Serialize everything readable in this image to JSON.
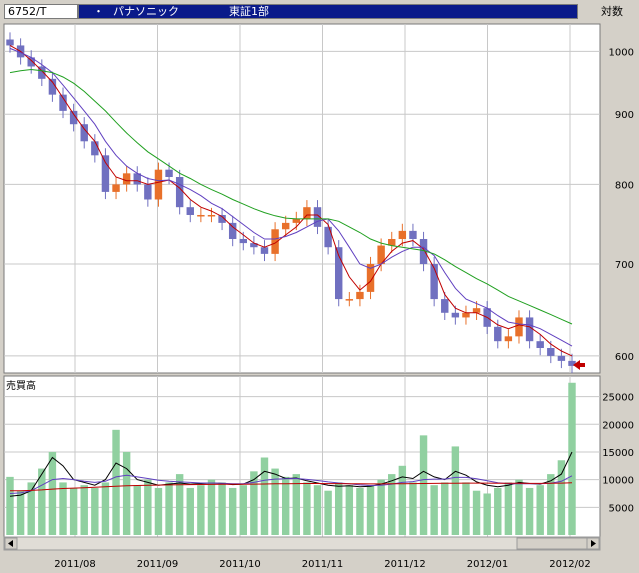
{
  "header": {
    "code": "6752/T",
    "bullet": "・",
    "name": "パナソニック",
    "market": "東証1部",
    "scale_button": "対数"
  },
  "chart_data": [
    {
      "type": "candlestick",
      "title": "",
      "log_scale": true,
      "ylim": [
        585,
        1040
      ],
      "yticks": [
        600,
        700,
        800,
        900,
        1000
      ],
      "grid": true,
      "x_labels": [
        "2011/08",
        "2011/09",
        "2011/10",
        "2011/11",
        "2011/12",
        "2012/01",
        "2012/02"
      ],
      "colors": {
        "up": "#e8702a",
        "down": "#7070c0",
        "ma_short": "#c00000",
        "ma_mid": "#6040c0",
        "ma_long": "#20a020"
      },
      "closes": [
        1010,
        990,
        975,
        955,
        930,
        905,
        885,
        860,
        840,
        790,
        800,
        815,
        800,
        780,
        820,
        810,
        770,
        760,
        760,
        760,
        750,
        730,
        725,
        720,
        712,
        742,
        750,
        755,
        770,
        745,
        720,
        660,
        660,
        668,
        700,
        722,
        730,
        740,
        730,
        700,
        660,
        645,
        640,
        645,
        650,
        630,
        615,
        620,
        640,
        615,
        608,
        600,
        595,
        590
      ],
      "series": [
        {
          "name": "",
          "color": "#c00000",
          "values": [
            1010,
            1000,
            985,
            968,
            950,
            925,
            900,
            878,
            860,
            830,
            810,
            805,
            805,
            800,
            803,
            806,
            795,
            780,
            770,
            765,
            758,
            745,
            735,
            725,
            720,
            725,
            735,
            745,
            760,
            760,
            748,
            710,
            685,
            670,
            680,
            700,
            715,
            725,
            728,
            718,
            695,
            665,
            650,
            645,
            645,
            640,
            632,
            628,
            632,
            630,
            622,
            612,
            605,
            600
          ]
        },
        {
          "name": "",
          "color": "#6040c0",
          "values": [
            1005,
            998,
            990,
            978,
            965,
            945,
            925,
            905,
            885,
            860,
            840,
            825,
            815,
            808,
            805,
            806,
            800,
            793,
            785,
            775,
            768,
            758,
            748,
            738,
            730,
            730,
            733,
            738,
            745,
            752,
            755,
            740,
            720,
            700,
            695,
            700,
            708,
            715,
            720,
            720,
            710,
            690,
            672,
            660,
            655,
            650,
            642,
            635,
            633,
            632,
            628,
            622,
            616,
            610
          ]
        },
        {
          "name": "",
          "color": "#20a020",
          "values": [
            965,
            968,
            970,
            968,
            965,
            958,
            948,
            935,
            920,
            905,
            888,
            872,
            858,
            845,
            835,
            825,
            815,
            808,
            800,
            793,
            787,
            780,
            774,
            768,
            763,
            759,
            756,
            755,
            755,
            755,
            755,
            752,
            745,
            738,
            730,
            725,
            722,
            720,
            718,
            716,
            712,
            705,
            697,
            690,
            683,
            677,
            670,
            663,
            658,
            653,
            648,
            643,
            638,
            633
          ]
        }
      ]
    },
    {
      "type": "bar",
      "title": "売買高",
      "ylim": [
        0,
        28000
      ],
      "yticks": [
        5000,
        10000,
        15000,
        20000,
        25000
      ],
      "grid": true,
      "bar_color": "#90d0a0",
      "values": [
        10500,
        8000,
        9500,
        12000,
        15000,
        9500,
        8500,
        9000,
        8500,
        9500,
        19000,
        15000,
        9000,
        10000,
        8500,
        9500,
        11000,
        8500,
        9000,
        10000,
        9500,
        8500,
        9000,
        11500,
        14000,
        12000,
        10500,
        11000,
        9500,
        9000,
        8000,
        9500,
        9000,
        8500,
        9000,
        10000,
        11000,
        12500,
        9500,
        18000,
        9000,
        9500,
        16000,
        9500,
        8000,
        7500,
        8500,
        9500,
        10000,
        8500,
        9000,
        11000,
        13500,
        27500
      ],
      "series": [
        {
          "name": "",
          "color": "#000000",
          "values": [
            7000,
            7200,
            8000,
            11000,
            14000,
            12500,
            10000,
            9500,
            9000,
            10000,
            13000,
            12000,
            10000,
            9500,
            9000,
            9200,
            9400,
            9200,
            9300,
            9400,
            9300,
            9100,
            9200,
            10000,
            11500,
            11000,
            10200,
            10300,
            9800,
            9400,
            9000,
            8800,
            8900,
            8700,
            8800,
            9200,
            9800,
            10500,
            10200,
            11500,
            10500,
            10000,
            11500,
            10800,
            9600,
            9000,
            8700,
            9000,
            9500,
            9300,
            9200,
            9800,
            11000,
            15000
          ]
        },
        {
          "name": "",
          "color": "#6040c0",
          "values": [
            7500,
            7600,
            8000,
            9000,
            10000,
            10200,
            10000,
            9700,
            9500,
            9700,
            10500,
            10800,
            10500,
            10200,
            9900,
            9700,
            9600,
            9500,
            9400,
            9400,
            9350,
            9250,
            9250,
            9500,
            9900,
            10100,
            10150,
            10200,
            10050,
            9850,
            9600,
            9400,
            9250,
            9050,
            8950,
            9000,
            9200,
            9500,
            9650,
            10000,
            10100,
            10100,
            10400,
            10400,
            10150,
            9800,
            9450,
            9250,
            9250,
            9250,
            9250,
            9350,
            9700,
            10700
          ]
        },
        {
          "name": "",
          "color": "#c00000",
          "values": [
            8000,
            8000,
            8050,
            8150,
            8300,
            8400,
            8480,
            8550,
            8620,
            8700,
            8800,
            8880,
            8940,
            8990,
            9020,
            9050,
            9080,
            9100,
            9120,
            9140,
            9150,
            9160,
            9170,
            9190,
            9220,
            9250,
            9270,
            9290,
            9300,
            9300,
            9290,
            9280,
            9270,
            9250,
            9240,
            9240,
            9250,
            9270,
            9280,
            9300,
            9320,
            9340,
            9360,
            9380,
            9380,
            9370,
            9360,
            9350,
            9340,
            9330,
            9330,
            9340,
            9370,
            9450
          ]
        }
      ]
    }
  ]
}
